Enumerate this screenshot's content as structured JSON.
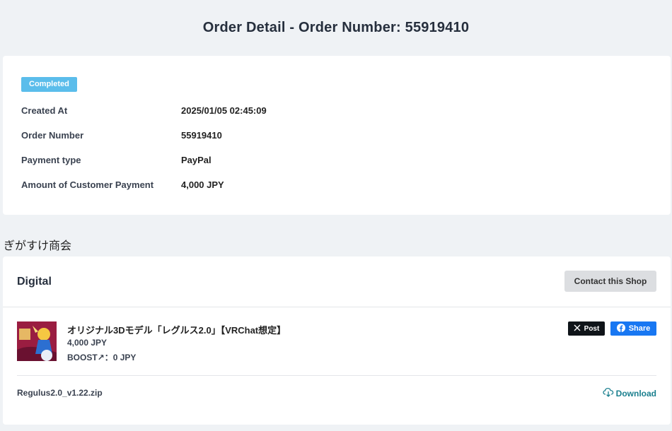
{
  "header": {
    "title": "Order Detail - Order Number: 55919410"
  },
  "order": {
    "status": "Completed",
    "rows": [
      {
        "label": "Created At",
        "value": "2025/01/05 02:45:09"
      },
      {
        "label": "Order Number",
        "value": "55919410"
      },
      {
        "label": "Payment type",
        "value": "PayPal"
      },
      {
        "label": "Amount of Customer Payment",
        "value": "4,000 JPY"
      }
    ]
  },
  "shop": {
    "name": "ぎがすけ商会",
    "section_title": "Digital",
    "contact_label": "Contact this Shop",
    "item": {
      "title": "オリジナル3Dモデル「レグルス2.0」【VRChat想定】",
      "price": "4,000 JPY",
      "boost": "BOOST↗︎：0 JPY",
      "thumbnail_icon": "product-thumbnail-image"
    },
    "share": {
      "x_label": "Post",
      "fb_label": "Share"
    },
    "file": {
      "name": "Regulus2.0_v1.22.zip",
      "download_label": "Download"
    }
  },
  "colors": {
    "badge": "#5bbdeb",
    "download": "#1a7f8e",
    "facebook": "#1877f2",
    "x": "#0f1419"
  }
}
